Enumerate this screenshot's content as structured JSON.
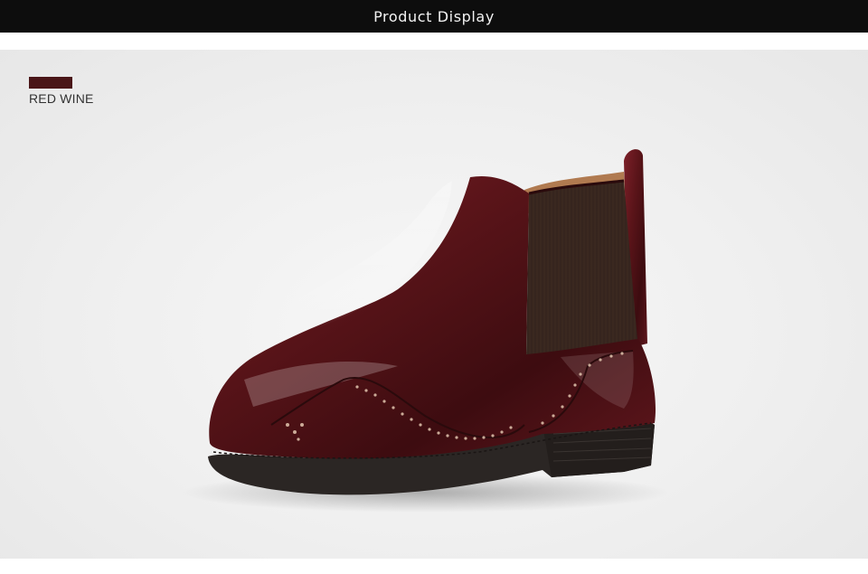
{
  "header": {
    "title": "Product Display"
  },
  "color_option": {
    "label": "RED WINE",
    "swatch_color": "#4a1618"
  },
  "product_image": {
    "subject": "boot-icon",
    "leather_color": "#5a1419",
    "elastic_color": "#3e2a22",
    "sole_color": "#2b2624"
  }
}
